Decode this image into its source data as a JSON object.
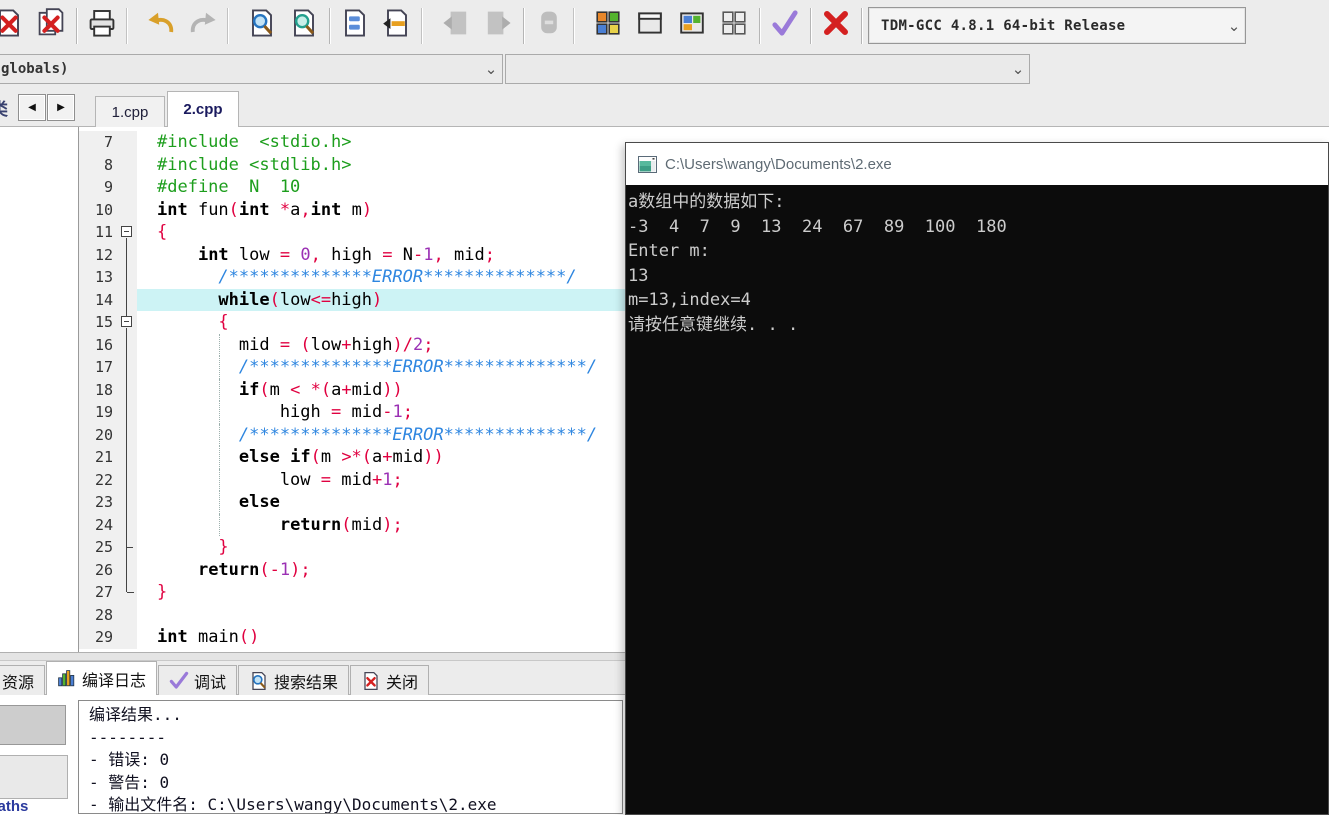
{
  "toolbar": {
    "compiler": "TDM-GCC 4.8.1 64-bit Release",
    "items": [
      "close-file",
      "close-all-files",
      "|",
      "print",
      "||",
      "undo",
      "redo",
      "||",
      "find",
      "find-in-files",
      "|",
      "replace",
      "goto-line",
      "||",
      "page-back",
      "page-forward",
      "|",
      "abort-disabled",
      "||",
      "new-project",
      "window",
      "tile-windows",
      "cascade-windows",
      "|",
      "syntax-check",
      "|",
      "abort-compilation",
      "|",
      "profile-analysis",
      "delete-profiling",
      "||"
    ]
  },
  "navrow": {
    "scope": "globals)",
    "member": ""
  },
  "tabs": {
    "left_fragment": "类",
    "items": [
      {
        "label": "1.cpp",
        "active": false
      },
      {
        "label": "2.cpp",
        "active": true
      }
    ]
  },
  "editor": {
    "lines": [
      {
        "n": 7,
        "s": [
          [
            "pp",
            "#include  <stdio.h>"
          ]
        ]
      },
      {
        "n": 8,
        "s": [
          [
            "pp",
            "#include <stdlib.h>"
          ]
        ]
      },
      {
        "n": 9,
        "s": [
          [
            "pp",
            "#define  N  10"
          ]
        ]
      },
      {
        "n": 10,
        "s": [
          [
            "kw",
            "int"
          ],
          [
            "id",
            " fun"
          ],
          [
            "op",
            "("
          ],
          [
            "kw",
            "int"
          ],
          [
            "id",
            " "
          ],
          [
            "op",
            "*"
          ],
          [
            "id",
            "a"
          ],
          [
            "op",
            ","
          ],
          [
            "kw",
            "int"
          ],
          [
            "id",
            " m"
          ],
          [
            "op",
            ")"
          ]
        ]
      },
      {
        "n": 11,
        "s": [
          [
            "op",
            "{"
          ]
        ],
        "f": "bf"
      },
      {
        "n": 12,
        "s": [
          [
            "id",
            "    "
          ],
          [
            "kw",
            "int"
          ],
          [
            "id",
            " low "
          ],
          [
            "op",
            "="
          ],
          [
            "id",
            " "
          ],
          [
            "num",
            "0"
          ],
          [
            "op",
            ","
          ],
          [
            "id",
            " high "
          ],
          [
            "op",
            "="
          ],
          [
            "id",
            " N"
          ],
          [
            "op",
            "-"
          ],
          [
            "num",
            "1"
          ],
          [
            "op",
            ","
          ],
          [
            "id",
            " mid"
          ],
          [
            "op",
            ";"
          ]
        ],
        "f": "fl"
      },
      {
        "n": 13,
        "s": [
          [
            "cm",
            "      /**************ERROR**************/"
          ]
        ],
        "f": "fl"
      },
      {
        "n": 14,
        "s": [
          [
            "id",
            "      "
          ],
          [
            "kw",
            "while"
          ],
          [
            "op",
            "("
          ],
          [
            "id",
            "low"
          ],
          [
            "op",
            "<="
          ],
          [
            "id",
            "high"
          ],
          [
            "op",
            ")"
          ]
        ],
        "f": "fl",
        "hl": true
      },
      {
        "n": 15,
        "s": [
          [
            "id",
            "      "
          ],
          [
            "op",
            "{"
          ]
        ],
        "f": "bm"
      },
      {
        "n": 16,
        "s": [
          [
            "id",
            "        mid "
          ],
          [
            "op",
            "="
          ],
          [
            "id",
            " "
          ],
          [
            "op",
            "("
          ],
          [
            "id",
            "low"
          ],
          [
            "op",
            "+"
          ],
          [
            "id",
            "high"
          ],
          [
            "op",
            ")/"
          ],
          [
            "num",
            "2"
          ],
          [
            "op",
            ";"
          ]
        ],
        "f": "fl",
        "g": true
      },
      {
        "n": 17,
        "s": [
          [
            "cm",
            "        /**************ERROR**************/"
          ]
        ],
        "f": "fl",
        "g": true
      },
      {
        "n": 18,
        "s": [
          [
            "id",
            "        "
          ],
          [
            "kw",
            "if"
          ],
          [
            "op",
            "("
          ],
          [
            "id",
            "m "
          ],
          [
            "op",
            "<"
          ],
          [
            "id",
            " "
          ],
          [
            "op",
            "*("
          ],
          [
            "id",
            "a"
          ],
          [
            "op",
            "+"
          ],
          [
            "id",
            "mid"
          ],
          [
            "op",
            "))"
          ]
        ],
        "f": "fl",
        "g": true
      },
      {
        "n": 19,
        "s": [
          [
            "id",
            "            high "
          ],
          [
            "op",
            "="
          ],
          [
            "id",
            " mid"
          ],
          [
            "op",
            "-"
          ],
          [
            "num",
            "1"
          ],
          [
            "op",
            ";"
          ]
        ],
        "f": "fl",
        "g": true
      },
      {
        "n": 20,
        "s": [
          [
            "cm",
            "        /**************ERROR**************/"
          ]
        ],
        "f": "fl",
        "g": true
      },
      {
        "n": 21,
        "s": [
          [
            "id",
            "        "
          ],
          [
            "kw",
            "else"
          ],
          [
            "id",
            " "
          ],
          [
            "kw",
            "if"
          ],
          [
            "op",
            "("
          ],
          [
            "id",
            "m "
          ],
          [
            "op",
            ">*("
          ],
          [
            "id",
            "a"
          ],
          [
            "op",
            "+"
          ],
          [
            "id",
            "mid"
          ],
          [
            "op",
            "))"
          ]
        ],
        "f": "fl",
        "g": true
      },
      {
        "n": 22,
        "s": [
          [
            "id",
            "            low "
          ],
          [
            "op",
            "="
          ],
          [
            "id",
            " mid"
          ],
          [
            "op",
            "+"
          ],
          [
            "num",
            "1"
          ],
          [
            "op",
            ";"
          ]
        ],
        "f": "fl",
        "g": true
      },
      {
        "n": 23,
        "s": [
          [
            "id",
            "        "
          ],
          [
            "kw",
            "else"
          ]
        ],
        "f": "fl",
        "g": true
      },
      {
        "n": 24,
        "s": [
          [
            "id",
            "            "
          ],
          [
            "kw",
            "return"
          ],
          [
            "op",
            "("
          ],
          [
            "id",
            "mid"
          ],
          [
            "op",
            ");"
          ]
        ],
        "f": "fl",
        "g": true
      },
      {
        "n": 25,
        "s": [
          [
            "id",
            "      "
          ],
          [
            "op",
            "}"
          ]
        ],
        "f": "tk"
      },
      {
        "n": 26,
        "s": [
          [
            "id",
            "    "
          ],
          [
            "kw",
            "return"
          ],
          [
            "op",
            "(-"
          ],
          [
            "num",
            "1"
          ],
          [
            "op",
            ");"
          ]
        ],
        "f": "fl"
      },
      {
        "n": 27,
        "s": [
          [
            "op",
            "}"
          ]
        ],
        "f": "en"
      },
      {
        "n": 28,
        "s": []
      },
      {
        "n": 29,
        "s": [
          [
            "kw",
            "int"
          ],
          [
            "id",
            " main"
          ],
          [
            "op",
            "()"
          ]
        ]
      }
    ]
  },
  "console": {
    "title": "C:\\Users\\wangy\\Documents\\2.exe",
    "lines": [
      "a数组中的数据如下:",
      "-3  4  7  9  13  24  67  89  100  180",
      "Enter m:",
      "13",
      "m=13,index=4",
      "请按任意键继续. . ."
    ]
  },
  "bottom_tabs": [
    {
      "name": "resources",
      "icon": "resources",
      "label": "资源",
      "active": false
    },
    {
      "name": "compile-log",
      "icon": "barchart",
      "label": "编译日志",
      "active": true
    },
    {
      "name": "debug",
      "icon": "check-sm",
      "label": "调试",
      "active": false
    },
    {
      "name": "search-results",
      "icon": "searchdoc",
      "label": "搜索结果",
      "active": false
    },
    {
      "name": "close",
      "icon": "closedoc",
      "label": "关闭",
      "active": false
    }
  ],
  "compile_log": {
    "lines": [
      "编译结果...",
      "--------",
      "- 错误: 0",
      "- 警告: 0",
      "- 输出文件名: C:\\Users\\wangy\\Documents\\2.exe"
    ]
  },
  "bottom_left": {
    "link_text": "er paths"
  },
  "colors": {
    "accent_highlight": "#cdf3f5",
    "comment": "#2e86e0",
    "keyword_red": "#e00040",
    "preprocessor_green": "#1d9e1d",
    "number_purple": "#9b30b4",
    "console_bg": "#0c0c0c",
    "console_text": "#cccccc"
  }
}
